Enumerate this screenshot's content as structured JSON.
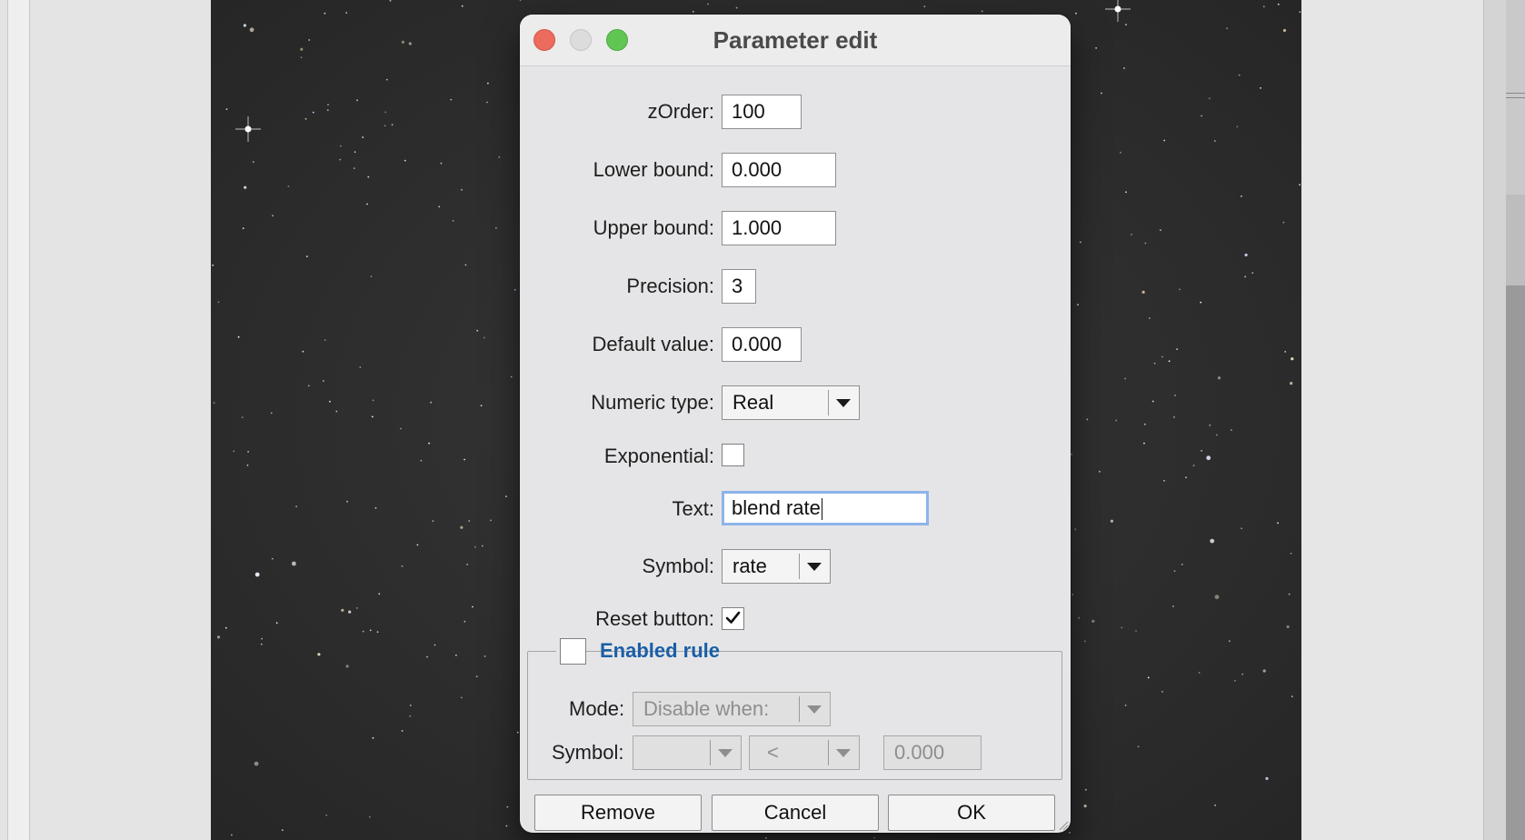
{
  "dialog": {
    "title": "Parameter edit",
    "traffic_lights": [
      "close-button",
      "minimize-button",
      "zoom-button"
    ]
  },
  "fields": {
    "zorder": {
      "label": "zOrder:",
      "value": "100"
    },
    "lower_bound": {
      "label": "Lower bound:",
      "value": "0.000"
    },
    "upper_bound": {
      "label": "Upper bound:",
      "value": "1.000"
    },
    "precision": {
      "label": "Precision:",
      "value": "3"
    },
    "default_value": {
      "label": "Default value:",
      "value": "0.000"
    },
    "numeric_type": {
      "label": "Numeric type:",
      "value": "Real"
    },
    "exponential": {
      "label": "Exponential:",
      "checked": false
    },
    "text": {
      "label": "Text:",
      "value": "blend rate"
    },
    "symbol": {
      "label": "Symbol:",
      "value": "rate"
    },
    "reset_button": {
      "label": "Reset button:",
      "checked": true
    }
  },
  "enabled_rule": {
    "title": "Enabled rule",
    "checked": false,
    "mode_label": "Mode:",
    "mode_value": "Disable when:",
    "symbol_label": "Symbol:",
    "symbol_value": "",
    "operator_value": "<",
    "threshold_value": "0.000"
  },
  "buttons": {
    "remove": "Remove",
    "cancel": "Cancel",
    "ok": "OK"
  },
  "colors": {
    "accent": "#1a5ea6",
    "focus_ring": "#8cb4ea",
    "close": "#ed6a5e",
    "zoom": "#61c554"
  }
}
